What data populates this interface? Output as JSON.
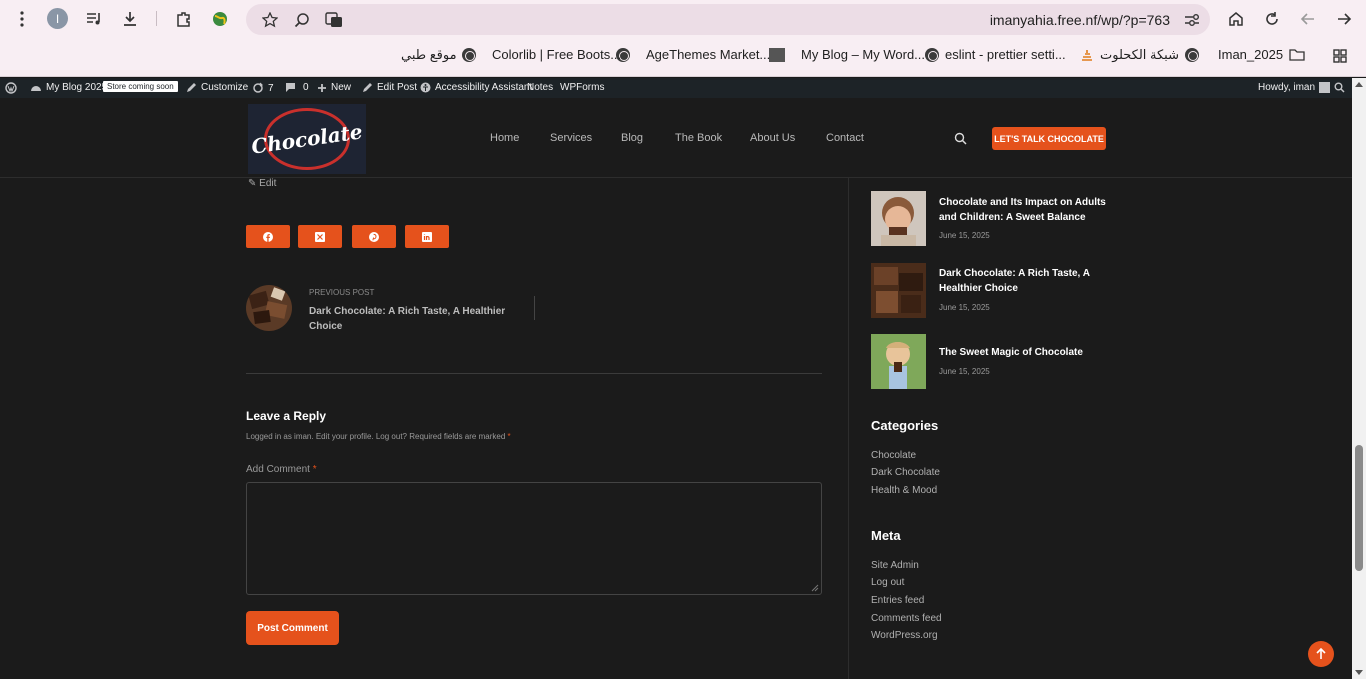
{
  "browser": {
    "profile_initial": "I",
    "url": "imanyahia.free.nf/wp/?p=763",
    "bookmarks": [
      {
        "label": "Iman_2025"
      },
      {
        "label": "شبكة الكحلوت"
      },
      {
        "label": "eslint - prettier setti..."
      },
      {
        "label": "My Blog – My Word..."
      },
      {
        "label": "AgeThemes Market..."
      },
      {
        "label": "Colorlib | Free Boots..."
      },
      {
        "label": "موقع طبي"
      }
    ]
  },
  "adminbar": {
    "site": "My Blog 2025",
    "badge": "Store coming soon",
    "customize": "Customize",
    "updates": "7",
    "comments": "0",
    "new": "New",
    "edit_post": "Edit Post",
    "accessibility": "Accessibility Assistant",
    "notes": "Notes",
    "wpforms": "WPForms",
    "howdy": "Howdy, iman"
  },
  "header": {
    "logo_text": "Chocolate",
    "nav": [
      "Home",
      "Services",
      "Blog",
      "The Book",
      "About Us",
      "Contact"
    ],
    "cta": "LET'S TALK CHOCOLATE"
  },
  "post": {
    "edit": "Edit",
    "share": [
      "facebook-icon",
      "x-icon",
      "pinterest-icon",
      "linkedin-icon"
    ],
    "prev_kicker": "PREVIOUS POST",
    "prev_title": "Dark Chocolate: A Rich Taste, A Healthier Choice"
  },
  "reply": {
    "title": "Leave a Reply",
    "logged_in": "Logged in as iman. Edit your profile. Log out? Required fields are marked",
    "req_mark": "*",
    "comment_label": "Add Comment",
    "submit": "Post Comment"
  },
  "sidebar": {
    "recent": [
      {
        "title": "Chocolate and Its Impact on Adults and Children: A Sweet Balance",
        "date": "June 15, 2025"
      },
      {
        "title": "Dark Chocolate: A Rich Taste, A Healthier Choice",
        "date": "June 15, 2025"
      },
      {
        "title": "The Sweet Magic of Chocolate",
        "date": "June 15, 2025"
      }
    ],
    "categories_title": "Categories",
    "categories": [
      "Chocolate",
      "Dark Chocolate",
      "Health & Mood"
    ],
    "meta_title": "Meta",
    "meta": [
      "Site Admin",
      "Log out",
      "Entries feed",
      "Comments feed",
      "WordPress.org"
    ]
  },
  "colors": {
    "accent": "#e5521c",
    "background": "#1b1b1b",
    "adminbar": "#1d2327"
  }
}
